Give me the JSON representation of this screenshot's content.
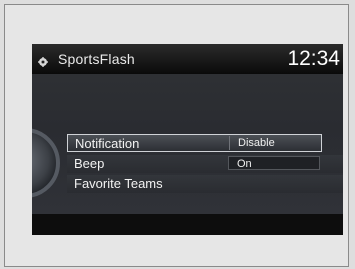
{
  "header": {
    "app_icon": "gear-icon",
    "title": "SportsFlash",
    "clock": "12:34"
  },
  "menu": {
    "items": [
      {
        "label": "Notification",
        "value": "Disable",
        "selected": true
      },
      {
        "label": "Beep",
        "value": "On",
        "selected": false
      },
      {
        "label": "Favorite Teams",
        "value": "",
        "selected": false
      }
    ]
  }
}
